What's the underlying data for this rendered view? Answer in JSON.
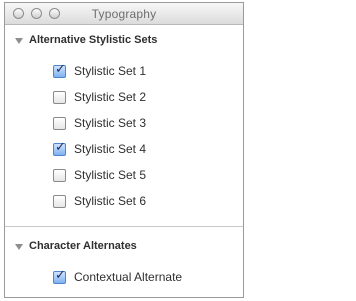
{
  "window": {
    "title": "Typography"
  },
  "sections": [
    {
      "title": "Alternative Stylistic Sets",
      "options": [
        {
          "label": "Stylistic Set 1",
          "checked": true
        },
        {
          "label": "Stylistic Set 2",
          "checked": false
        },
        {
          "label": "Stylistic Set 3",
          "checked": false
        },
        {
          "label": "Stylistic Set 4",
          "checked": true
        },
        {
          "label": "Stylistic Set 5",
          "checked": false
        },
        {
          "label": "Stylistic Set 6",
          "checked": false
        }
      ]
    },
    {
      "title": "Character Alternates",
      "options": [
        {
          "label": "Contextual Alternate",
          "checked": true
        }
      ]
    }
  ],
  "colors": {
    "checked_fill": "#7fb2f0",
    "checked_border": "#4f86c9",
    "text": "#2f2f2f"
  }
}
